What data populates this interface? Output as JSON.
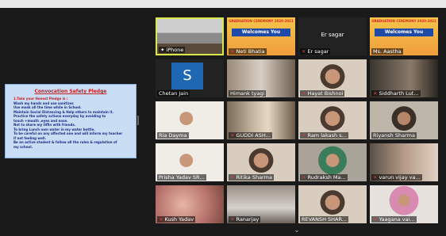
{
  "share_content": {
    "title": "Convocation Safety Pledge",
    "lines": [
      "1.Take your Honest Pledge is :",
      "Wash my hands and use sanitizer.",
      "Use mask all the time while in  School.",
      "Maintain  Social Distancing & Help others to maintain it.",
      "Practice the safety actions everyday by avoiding  to",
      "touch  +mouth ,eyes and nose.",
      "Not to share my tiffin with friends.",
      "To bring Lunch  own water in my water bottle.",
      "To be careful on any affected one and will inform my teacher",
      "if not feeling well.",
      "Be an active student & follow all the rules  & regulation of",
      "my school."
    ]
  },
  "participants": [
    {
      "name": "iPhone",
      "muted": false,
      "pinned": true,
      "active": true,
      "scene": "person-desk"
    },
    {
      "name": "Neti Bhatia",
      "muted": true,
      "scene": "graduation",
      "banner": "Welcomes You",
      "header": "GRADUATION CEREMONY 2020-2021"
    },
    {
      "name": "Er sagar",
      "muted": true,
      "scene": "no-video"
    },
    {
      "name": "Ms. Aastha",
      "muted": false,
      "scene": "graduation",
      "banner": "Welcomes You",
      "header": "GRADUATION CEREMONY 2020-2021"
    },
    {
      "name": "Chetan Jain",
      "muted": false,
      "scene": "avatar",
      "avatar_letter": "S"
    },
    {
      "name": "Himank tyagi",
      "muted": false,
      "scene": "room"
    },
    {
      "name": "Hayat Bishnoi",
      "muted": true,
      "scene": "child"
    },
    {
      "name": "Siddharth Lut...",
      "muted": true,
      "scene": "room-dark"
    },
    {
      "name": "Ria Dayma",
      "muted": false,
      "scene": "child-white"
    },
    {
      "name": "GUDDI ASH...",
      "muted": true,
      "scene": "curtain"
    },
    {
      "name": "Ram lakash s...",
      "muted": true,
      "scene": "child"
    },
    {
      "name": "Riyansh Sharma",
      "muted": false,
      "scene": "child-dark"
    },
    {
      "name": "Prisha Yadav SR...",
      "muted": false,
      "scene": "child-white"
    },
    {
      "name": "Ritika Sharma",
      "muted": true,
      "scene": "child"
    },
    {
      "name": "Rudraksh Ma...",
      "muted": true,
      "scene": "child-green"
    },
    {
      "name": "varun vijay va...",
      "muted": true,
      "scene": "group"
    },
    {
      "name": "Kush Yadav",
      "muted": true,
      "scene": "blur-skin"
    },
    {
      "name": "Ranarjay",
      "muted": true,
      "scene": "ceiling"
    },
    {
      "name": "REVANSH SHAR...",
      "muted": false,
      "scene": "child"
    },
    {
      "name": "Yaagana vai...",
      "muted": true,
      "scene": "child-pink"
    }
  ],
  "controls": {
    "expand_icon": "chevron-down-icon",
    "caret_glyph": "⌄"
  },
  "colors": {
    "active_border": "#d7e84a",
    "muted_mic": "#e83b3b",
    "share_bg": "#c9ddf4"
  }
}
